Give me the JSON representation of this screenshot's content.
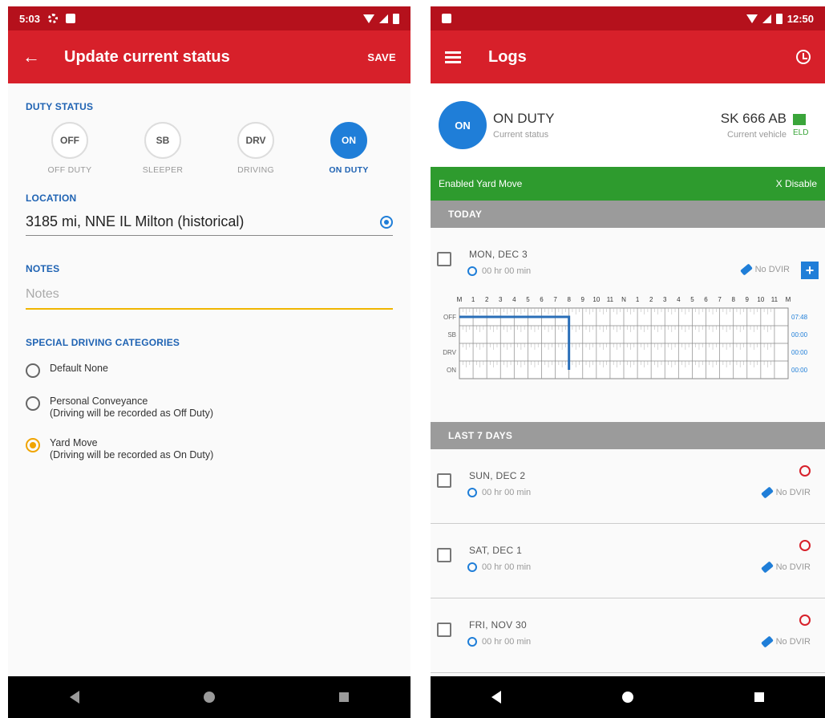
{
  "left_phone": {
    "statusbar": {
      "time": "5:03"
    },
    "appbar": {
      "title": "Update current status",
      "save_label": "SAVE"
    },
    "duty_status": {
      "label": "DUTY STATUS",
      "options": [
        {
          "code": "OFF",
          "caption": "OFF DUTY",
          "active": false
        },
        {
          "code": "SB",
          "caption": "SLEEPER",
          "active": false
        },
        {
          "code": "DRV",
          "caption": "DRIVING",
          "active": false
        },
        {
          "code": "ON",
          "caption": "ON DUTY",
          "active": true
        }
      ]
    },
    "location": {
      "label": "LOCATION",
      "value": "3185 mi, NNE IL Milton (historical)"
    },
    "notes": {
      "label": "NOTES",
      "placeholder": "Notes",
      "value": ""
    },
    "special": {
      "label": "SPECIAL DRIVING CATEGORIES",
      "options": [
        {
          "title": "Default None",
          "subtitle": "",
          "checked": false
        },
        {
          "title": "Personal Conveyance",
          "subtitle": "(Driving will be recorded as Off Duty)",
          "checked": false
        },
        {
          "title": "Yard Move",
          "subtitle": "(Driving will be recorded as On Duty)",
          "checked": true
        }
      ]
    }
  },
  "right_phone": {
    "statusbar": {
      "time": "12:50"
    },
    "appbar": {
      "title": "Logs"
    },
    "status_header": {
      "badge": "ON",
      "status": "ON DUTY",
      "status_caption": "Current status",
      "vehicle": "SK 666 AB",
      "vehicle_caption": "Current vehicle",
      "eld_label": "ELD"
    },
    "yard_banner": {
      "text": "Enabled Yard Move",
      "disable_label": "X Disable"
    },
    "today": {
      "label": "TODAY",
      "day": "MON, DEC 3",
      "time": "00 hr 00 min",
      "dvir": "No DVIR",
      "plus": "+",
      "hours_header": [
        "M",
        "1",
        "2",
        "3",
        "4",
        "5",
        "6",
        "7",
        "8",
        "9",
        "10",
        "11",
        "N",
        "1",
        "2",
        "3",
        "4",
        "5",
        "6",
        "7",
        "8",
        "9",
        "10",
        "11",
        "M"
      ],
      "rows": [
        "OFF",
        "SB",
        "DRV",
        "ON"
      ],
      "row_totals": [
        "07:48",
        "00:00",
        "00:00",
        "00:00"
      ],
      "status_change_hour": 8
    },
    "last7": {
      "label": "LAST 7 DAYS",
      "days": [
        {
          "day": "SUN, DEC 2",
          "time": "00 hr 00 min",
          "dvir": "No DVIR"
        },
        {
          "day": "SAT, DEC 1",
          "time": "00 hr 00 min",
          "dvir": "No DVIR"
        },
        {
          "day": "FRI, NOV 30",
          "time": "00 hr 00 min",
          "dvir": "No DVIR"
        }
      ]
    }
  },
  "colors": {
    "statusbar": "#b5111c",
    "appbar": "#d7202a",
    "accent_blue": "#1f7ed8",
    "banner_green": "#2e9b2e",
    "section_gray": "#9b9b9b",
    "radio_orange": "#f0a400"
  },
  "icons": [
    "back-arrow-icon",
    "gear-icon",
    "menu-icon",
    "alarm-clock-icon",
    "target-icon",
    "clock-icon",
    "wrench-icon",
    "warning-icon",
    "eld-icon"
  ]
}
